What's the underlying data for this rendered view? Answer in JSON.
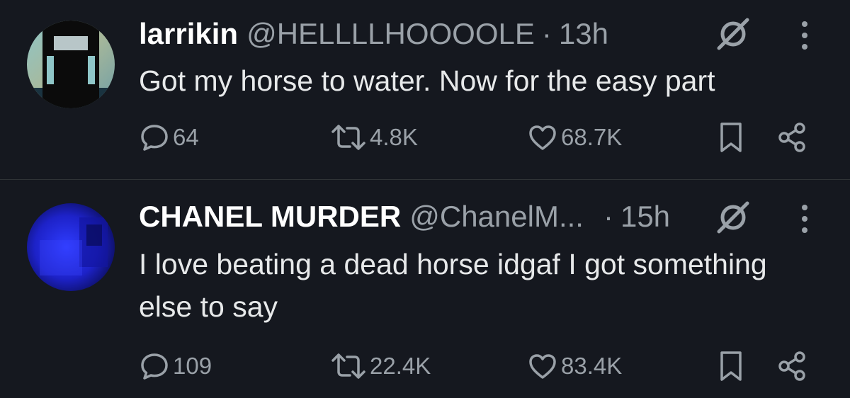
{
  "tweets": [
    {
      "author": {
        "name": "larrikin",
        "handle": "@HELLLLHOOOOLE",
        "avatar": "dark-block-figure-avatar"
      },
      "separator": "·",
      "time": "13h",
      "text": "Got my horse to water. Now for the easy part",
      "actions": {
        "replies": "64",
        "retweets": "4.8K",
        "likes": "68.7K"
      }
    },
    {
      "author": {
        "name": "CHANEL MURDER",
        "handle": "@ChanelM...",
        "avatar": "blue-figure-avatar"
      },
      "separator": "·",
      "time": "15h",
      "text": "I love beating a dead horse idgaf I got something else to say",
      "actions": {
        "replies": "109",
        "retweets": "22.4K",
        "likes": "83.4K"
      }
    }
  ],
  "icons": {
    "reply": "comment-bubble-icon",
    "retweet": "retweet-arrows-icon",
    "like": "heart-icon",
    "bookmark": "bookmark-icon",
    "share": "share-nodes-icon",
    "grok": "grok-slash-circle-icon",
    "more": "vertical-ellipsis-icon"
  },
  "colors": {
    "background": "#15181f",
    "text": "#e7e9ea",
    "secondary": "#9aa1a8",
    "divider": "#2f3336"
  }
}
